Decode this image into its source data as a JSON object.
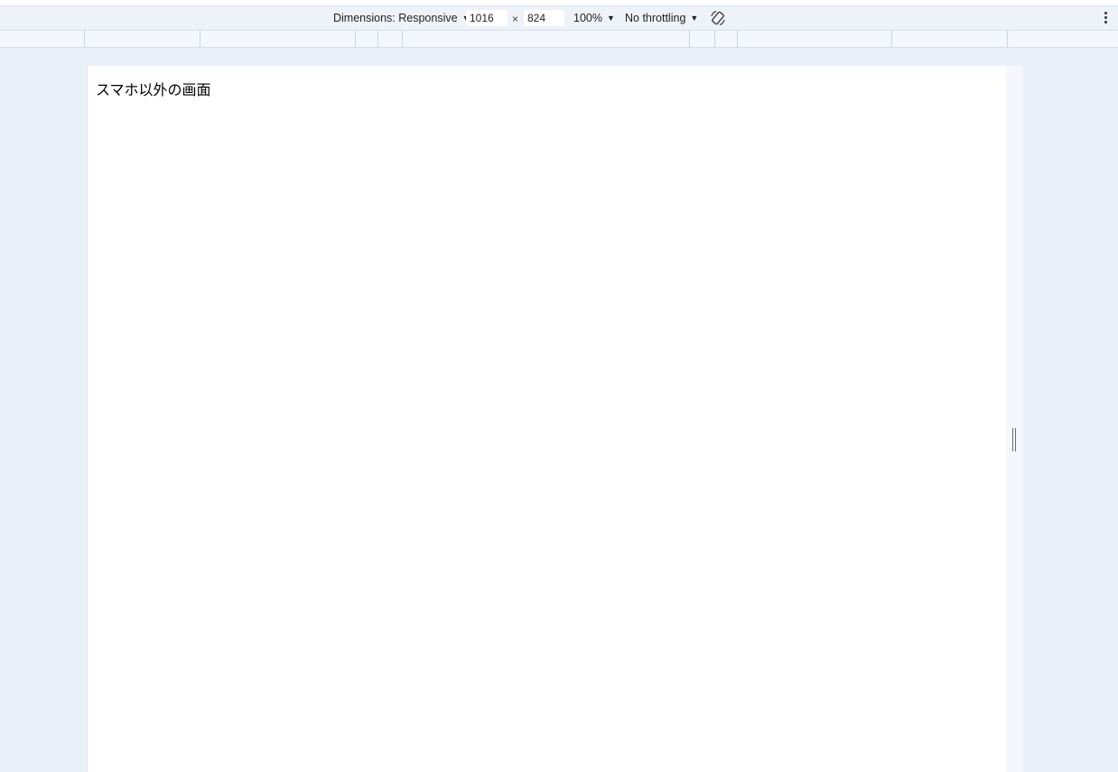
{
  "toolbar": {
    "dimensions_label": "Dimensions: Responsive",
    "width_value": "1016",
    "times_symbol": "×",
    "height_value": "824",
    "zoom_label": "100%",
    "throttling_label": "No throttling",
    "rotate_icon": "rotate-device-icon",
    "more_icon": "more-vertical-icon",
    "caret_glyph": "▼"
  },
  "viewport": {
    "text": "スマホ以外の画面"
  }
}
